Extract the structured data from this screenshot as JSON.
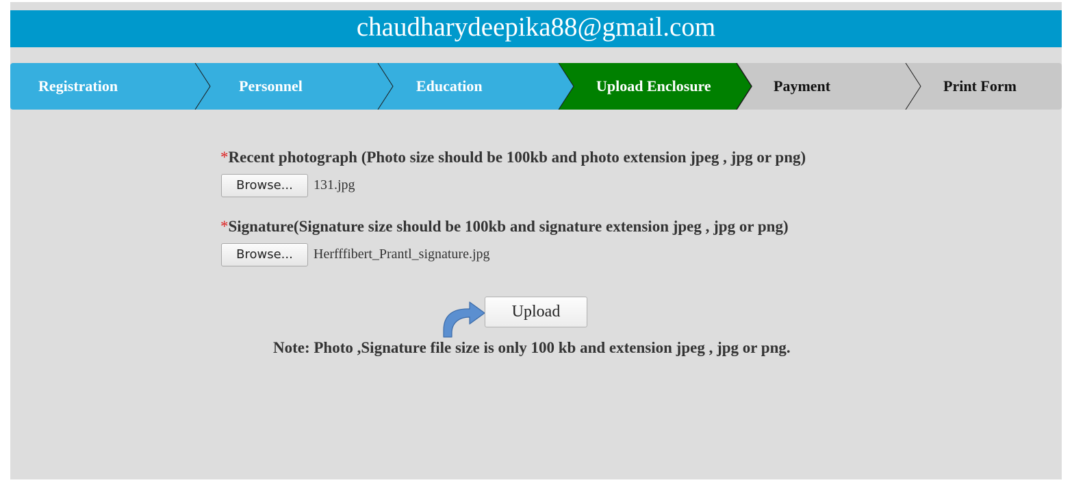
{
  "header": {
    "email": "chaudharydeepika88@gmail.com"
  },
  "steps": [
    {
      "label": "Registration",
      "state": "complete"
    },
    {
      "label": "Personnel",
      "state": "complete"
    },
    {
      "label": "Education",
      "state": "complete"
    },
    {
      "label": "Upload Enclosure",
      "state": "active"
    },
    {
      "label": "Payment",
      "state": "pending"
    },
    {
      "label": "Print Form",
      "state": "pending"
    }
  ],
  "colors": {
    "header_bg": "#0099cc",
    "step_complete": "#36afdf",
    "step_active": "#008000",
    "step_pending": "#c8c8c8",
    "panel_bg": "#dddddd",
    "required_mark": "#dd2222"
  },
  "form": {
    "required_mark": "*",
    "photo": {
      "label": "Recent photograph (Photo size should be 100kb and photo extension jpeg , jpg or png)",
      "browse_label": "Browse...",
      "file_name": "131.jpg"
    },
    "signature": {
      "label": "Signature(Signature size should be 100kb and signature extension jpeg , jpg or png)",
      "browse_label": "Browse...",
      "file_name": "Herfffibert_Prantl_signature.jpg"
    },
    "upload_label": "Upload",
    "note": "Note: Photo ,Signature file size is only 100 kb and extension jpeg , jpg or png."
  },
  "icons": {
    "upload_pointer": "curved-arrow-icon"
  }
}
